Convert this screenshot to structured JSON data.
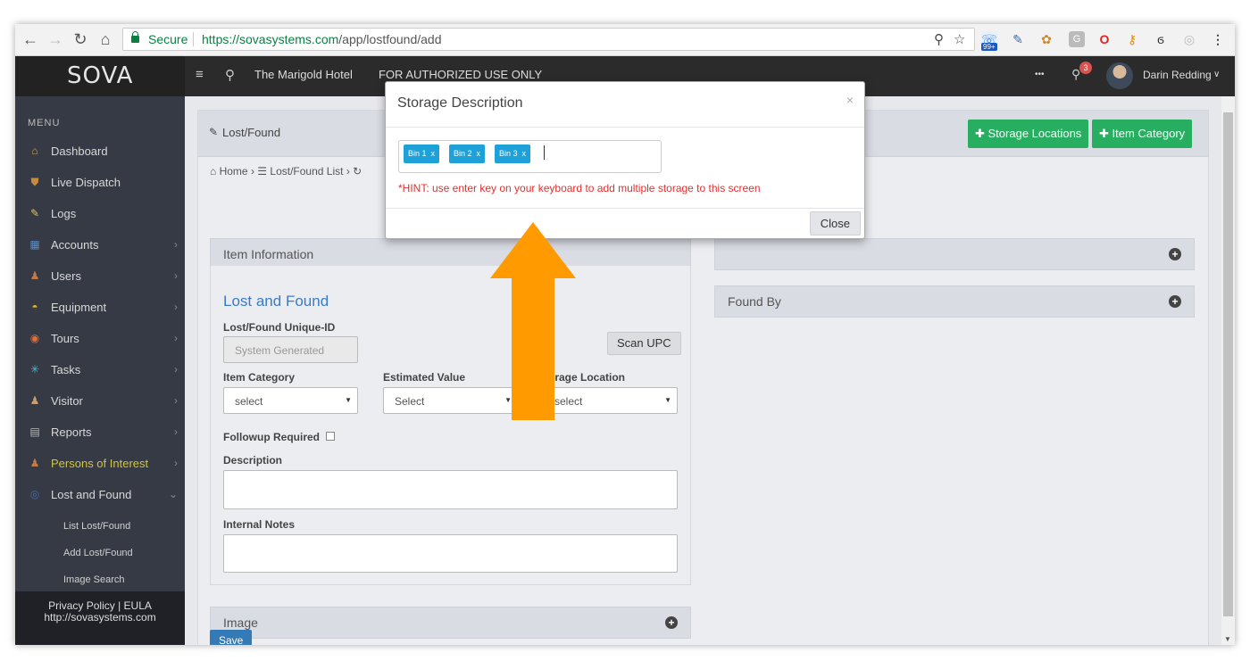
{
  "browser": {
    "secure_label": "Secure",
    "url_host": "https://sovasystems.com",
    "url_path": "/app/lostfound/add",
    "ext_badge": "99+"
  },
  "header": {
    "logo": "SOVA",
    "hotel": "The Marigold Hotel",
    "notice": "FOR AUTHORIZED USE ONLY",
    "more": "•••",
    "notif_count": "3",
    "user": "Darin Redding"
  },
  "sidebar": {
    "menu_title": "MENU",
    "items": [
      {
        "label": "Dashboard",
        "icon": "home-icon",
        "chevron": false,
        "color": "#d8d8d8"
      },
      {
        "label": "Live Dispatch",
        "icon": "shield-icon",
        "chevron": false,
        "color": "#d8d8d8"
      },
      {
        "label": "Logs",
        "icon": "pencil-icon",
        "chevron": false,
        "color": "#d8d8d8"
      },
      {
        "label": "Accounts",
        "icon": "building-icon",
        "chevron": true,
        "color": "#d8d8d8"
      },
      {
        "label": "Users",
        "icon": "user-icon",
        "chevron": true,
        "color": "#d8d8d8"
      },
      {
        "label": "Equipment",
        "icon": "helmet-icon",
        "chevron": true,
        "color": "#d8d8d8"
      },
      {
        "label": "Tours",
        "icon": "tour-icon",
        "chevron": true,
        "color": "#d8d8d8"
      },
      {
        "label": "Tasks",
        "icon": "tasks-icon",
        "chevron": true,
        "color": "#d8d8d8"
      },
      {
        "label": "Visitor",
        "icon": "visitor-icon",
        "chevron": true,
        "color": "#d8d8d8"
      },
      {
        "label": "Reports",
        "icon": "report-icon",
        "chevron": true,
        "color": "#d8d8d8"
      },
      {
        "label": "Persons of Interest",
        "icon": "person-icon",
        "chevron": true,
        "color": "#d4c43a"
      },
      {
        "label": "Lost and Found",
        "icon": "target-icon",
        "chevron": true,
        "color": "#d8d8d8"
      }
    ],
    "sub_items": [
      "List Lost/Found",
      "Add Lost/Found",
      "Image Search"
    ],
    "footer_line1": "Privacy Policy | EULA",
    "footer_line2": "http://sovasystems.com"
  },
  "page": {
    "title": "Lost/Found",
    "storage_btn": "Storage Locations",
    "category_btn": "Item Category",
    "breadcrumb_home": "Home",
    "breadcrumb_list": "Lost/Found List",
    "item_info": "Item Information",
    "section_title": "Lost and Found",
    "uid_label": "Lost/Found Unique-ID",
    "uid_placeholder": "System Generated",
    "scan_btn": "Scan UPC",
    "category_label": "Item Category",
    "category_value": "select",
    "value_label": "Estimated Value",
    "value_value": "Select",
    "storage_label": "orage Location",
    "storage_value": "select",
    "followup_label": "Followup Required",
    "description_label": "Description",
    "notes_label": "Internal Notes",
    "image_panel": "Image",
    "found_by_panel": "Found By",
    "save_btn": "Save"
  },
  "modal": {
    "title": "Storage Description",
    "close_x": "×",
    "tags": [
      "Bin 1",
      "Bin 2",
      "Bin 3"
    ],
    "tag_remove": "x",
    "hint": "*HINT: use enter key on your keyboard to add multiple storage to this screen",
    "close_btn": "Close"
  },
  "colors": {
    "accent_green": "#27ae60",
    "tag_blue": "#1da1d8",
    "arrow_orange": "#ff9a00",
    "hint_red": "#e03030"
  }
}
